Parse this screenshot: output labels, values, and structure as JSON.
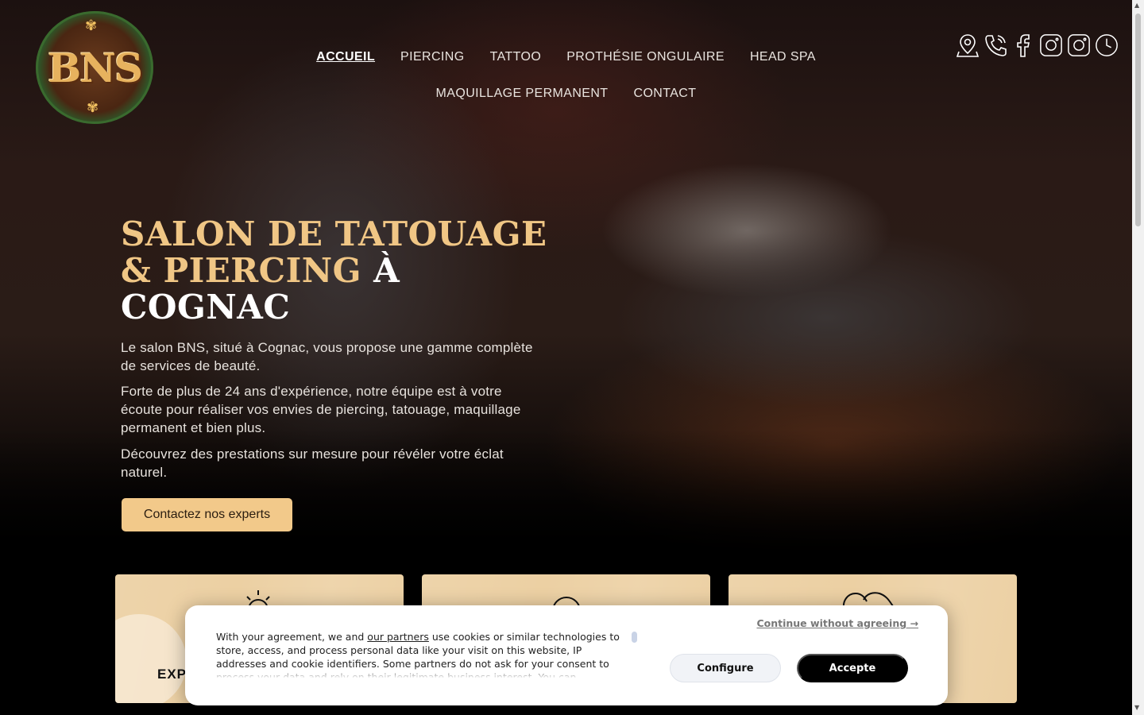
{
  "logo": {
    "text": "BNS"
  },
  "nav": {
    "items": [
      {
        "label": "ACCUEIL",
        "active": true
      },
      {
        "label": "PIERCING"
      },
      {
        "label": "TATTOO"
      },
      {
        "label": "PROTHÉSIE ONGULAIRE"
      },
      {
        "label": "HEAD SPA"
      },
      {
        "label": "MAQUILLAGE PERMANENT"
      },
      {
        "label": "CONTACT"
      }
    ]
  },
  "social_icons": [
    "location-pin-icon",
    "phone-icon",
    "facebook-icon",
    "instagram-icon",
    "instagram-icon",
    "clock-icon"
  ],
  "hero": {
    "title_line_gold": "SALON DE TATOUAGE & PIERCING",
    "title_line_white": "À COGNAC",
    "paragraphs": [
      "Le salon BNS, situé à Cognac, vous propose une gamme complète de services de beauté.",
      "Forte de plus de 24 ans d'expérience, notre équipe est à votre écoute pour réaliser vos envies de piercing, tatouage, maquillage permanent et bien plus.",
      "Découvrez des prestations sur mesure pour révéler votre éclat naturel."
    ],
    "cta_label": "Contactez nos experts"
  },
  "cards": [
    {
      "icon": "sun-icon",
      "title": "EXP"
    },
    {
      "icon": "circle-icon",
      "title": ""
    },
    {
      "icon": "hearts-icon",
      "title": ""
    }
  ],
  "cookie": {
    "text_before_link": "With your agreement, we and ",
    "link_label": "our partners",
    "text_after_link": " use cookies or similar technologies to store, access, and process personal data like your visit on this website, IP addresses and cookie identifiers. Some partners do not ask for your consent to process your data and rely on their legitimate business interest. You can",
    "continue_label": "Continue without agreeing →",
    "configure_label": "Configure",
    "accept_label": "Accepte"
  },
  "colors": {
    "accent_gold": "#f0c685",
    "button_gold": "#f2c98a",
    "card_bg": "#ecd0a3"
  }
}
